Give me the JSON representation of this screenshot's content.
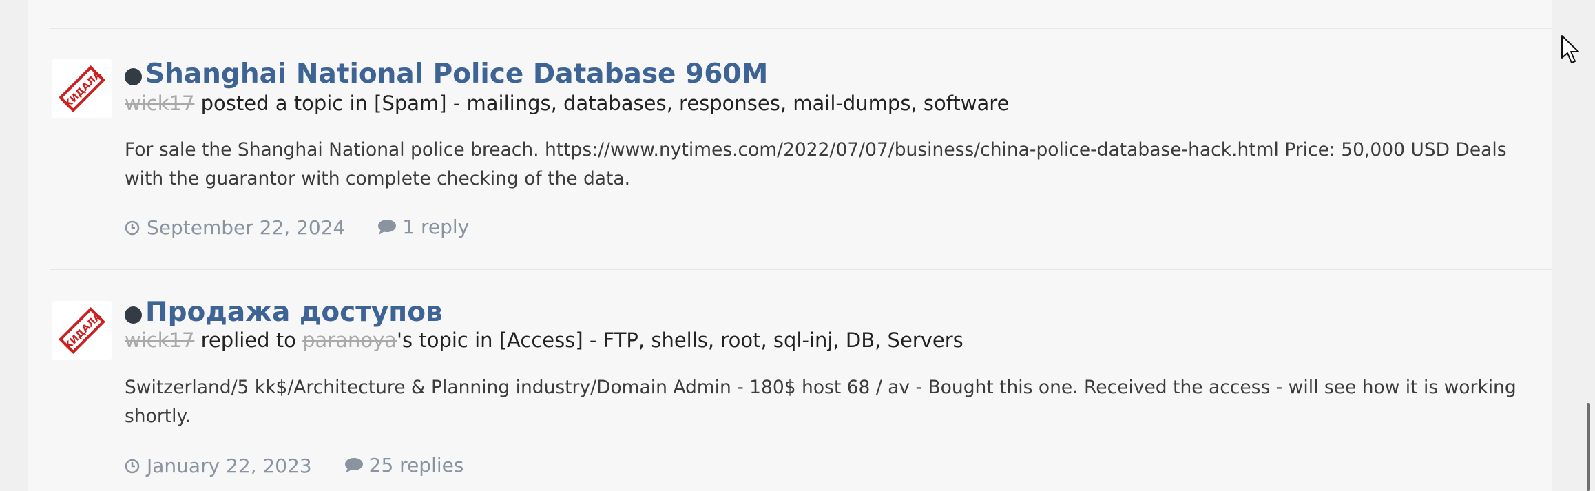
{
  "items": [
    {
      "title": "Shanghai National Police Database 960M",
      "author": "wick17",
      "action": "posted a topic in",
      "forum": "[Spam] - mailings, databases, responses, mail-dumps, software",
      "snippet": "For sale the Shanghai National police breach. https://www.nytimes.com/2022/07/07/business/china-police-database-hack.html Price: 50,000 USD Deals with the guarantor with complete checking of the data.",
      "date": "September 22, 2024",
      "replies": "1 reply"
    },
    {
      "title": "Продажа доступов",
      "author": "wick17",
      "action": "replied to",
      "topic_owner": "paranoya",
      "topic_suffix": "'s topic in",
      "forum": "[Access] - FTP, shells, root, sql-inj, DB, Servers",
      "snippet": "Switzerland/5 kk$/Architecture & Planning industry/Domain Admin - 180$ host 68 / av - Bought this one. Received the access - will see how it is working shortly.",
      "date": "January 22, 2023",
      "replies": "25 replies"
    }
  ],
  "avatar_stamp": "КИДАЛА",
  "colors": {
    "title": "#3e6495",
    "stamp": "#cc1f1f",
    "muted": "#8a94a0"
  }
}
